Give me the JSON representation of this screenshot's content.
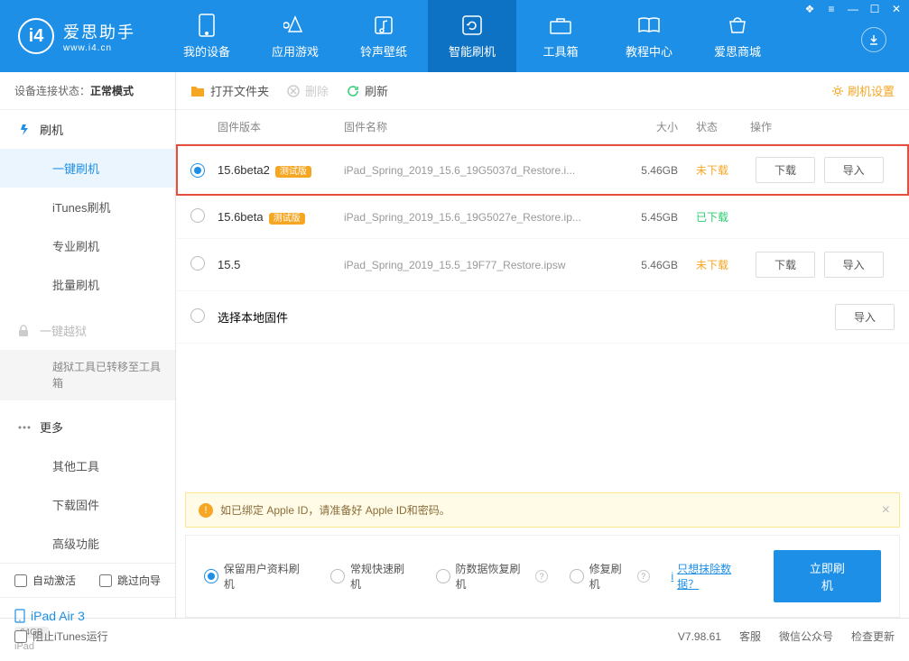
{
  "app": {
    "name": "爱思助手",
    "url": "www.i4.cn"
  },
  "nav": {
    "items": [
      {
        "label": "我的设备"
      },
      {
        "label": "应用游戏"
      },
      {
        "label": "铃声壁纸"
      },
      {
        "label": "智能刷机"
      },
      {
        "label": "工具箱"
      },
      {
        "label": "教程中心"
      },
      {
        "label": "爱思商城"
      }
    ]
  },
  "sidebar": {
    "status_label": "设备连接状态：",
    "status_value": "正常模式",
    "flash_header": "刷机",
    "items": {
      "one_click": "一键刷机",
      "itunes": "iTunes刷机",
      "pro": "专业刷机",
      "batch": "批量刷机"
    },
    "jailbreak_header": "一键越狱",
    "jailbreak_note": "越狱工具已转移至工具箱",
    "more_header": "更多",
    "more": {
      "other_tools": "其他工具",
      "download_fw": "下载固件",
      "advanced": "高级功能"
    },
    "auto_activate": "自动激活",
    "skip_guide": "跳过向导",
    "device": {
      "name": "iPad Air 3",
      "capacity": "64GB",
      "type": "iPad"
    }
  },
  "toolbar": {
    "open_folder": "打开文件夹",
    "delete": "删除",
    "refresh": "刷新",
    "settings": "刷机设置"
  },
  "table": {
    "headers": {
      "version": "固件版本",
      "name": "固件名称",
      "size": "大小",
      "status": "状态",
      "action": "操作"
    },
    "rows": [
      {
        "version": "15.6beta2",
        "beta": "测试版",
        "name": "iPad_Spring_2019_15.6_19G5037d_Restore.i...",
        "size": "5.46GB",
        "status": "未下载",
        "status_class": "not",
        "selected": true,
        "download": "下载",
        "import": "导入"
      },
      {
        "version": "15.6beta",
        "beta": "测试版",
        "name": "iPad_Spring_2019_15.6_19G5027e_Restore.ip...",
        "size": "5.45GB",
        "status": "已下载",
        "status_class": "done",
        "selected": false
      },
      {
        "version": "15.5",
        "beta": "",
        "name": "iPad_Spring_2019_15.5_19F77_Restore.ipsw",
        "size": "5.46GB",
        "status": "未下载",
        "status_class": "not",
        "selected": false,
        "download": "下载",
        "import": "导入"
      }
    ],
    "local_label": "选择本地固件",
    "local_import": "导入"
  },
  "notice": "如已绑定 Apple ID，请准备好 Apple ID和密码。",
  "flash": {
    "opts": {
      "keep_data": "保留用户资料刷机",
      "normal": "常规快速刷机",
      "anti_loss": "防数据恢复刷机",
      "repair": "修复刷机"
    },
    "erase_link": "只想抹除数据？",
    "button": "立即刷机"
  },
  "footer": {
    "block_itunes": "阻止iTunes运行",
    "version": "V7.98.61",
    "service": "客服",
    "wechat": "微信公众号",
    "update": "检查更新"
  }
}
